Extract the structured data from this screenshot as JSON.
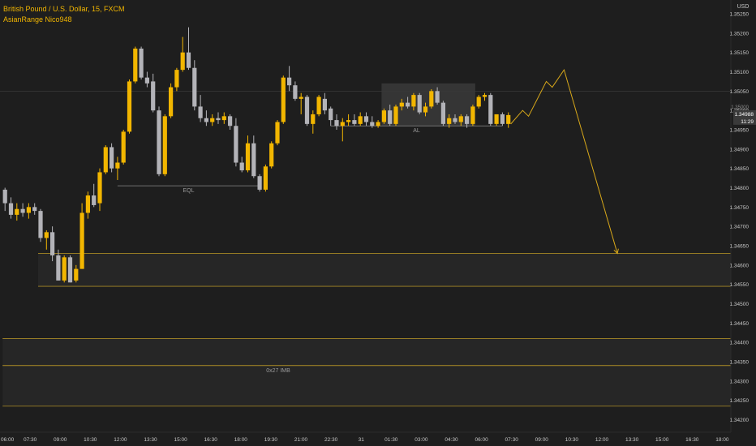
{
  "legend": {
    "symbol_line": "British Pound / U.S. Dollar, 15, FXCM",
    "indicator_line": "AsianRange Nico948"
  },
  "price_axis": {
    "currency": "USD",
    "current_price": "1.34988",
    "countdown": "11:29",
    "partial_label": "1.35000"
  },
  "colors": {
    "background": "#1e1e1e",
    "bull": "#f2b600",
    "bear": "#b3b3b8",
    "level_line": "#c9a227",
    "axis_text": "#c8c8c8",
    "projection": "#d8a81a"
  },
  "chart_data": {
    "type": "candlestick",
    "title": "British Pound / U.S. Dollar, 15, FXCM",
    "ylim": [
      1.34215,
      1.35275
    ],
    "y_ticks": [
      "1.35250",
      "1.35200",
      "1.35150",
      "1.35100",
      "1.35050",
      "1.35000",
      "1.34950",
      "1.34900",
      "1.34850",
      "1.34800",
      "1.34750",
      "1.34700",
      "1.34650",
      "1.34600",
      "1.34550",
      "1.34500",
      "1.34450",
      "1.34400",
      "1.34350",
      "1.34300",
      "1.34250",
      "1.34200"
    ],
    "x_tick_labels": [
      "06:00",
      "07:30",
      "09:00",
      "10:30",
      "12:00",
      "13:30",
      "15:00",
      "16:30",
      "18:00",
      "19:30",
      "21:00",
      "22:30",
      "31",
      "01:30",
      "03:00",
      "04:30",
      "06:00",
      "07:30",
      "09:00",
      "10:30",
      "12:00",
      "13:30",
      "15:00",
      "16:30",
      "18:00"
    ],
    "bar_interval_minutes": 15,
    "candles": [
      {
        "o": 1.34795,
        "h": 1.348,
        "l": 1.3474,
        "c": 1.3476
      },
      {
        "o": 1.3476,
        "h": 1.34775,
        "l": 1.3472,
        "c": 1.3473
      },
      {
        "o": 1.3473,
        "h": 1.3476,
        "l": 1.34715,
        "c": 1.34745
      },
      {
        "o": 1.34745,
        "h": 1.3476,
        "l": 1.34725,
        "c": 1.34735
      },
      {
        "o": 1.34735,
        "h": 1.3476,
        "l": 1.3472,
        "c": 1.3475
      },
      {
        "o": 1.3475,
        "h": 1.3476,
        "l": 1.3473,
        "c": 1.3474
      },
      {
        "o": 1.3474,
        "h": 1.34745,
        "l": 1.3466,
        "c": 1.3467
      },
      {
        "o": 1.3467,
        "h": 1.3469,
        "l": 1.3464,
        "c": 1.34685
      },
      {
        "o": 1.34685,
        "h": 1.347,
        "l": 1.3461,
        "c": 1.34625
      },
      {
        "o": 1.34625,
        "h": 1.3464,
        "l": 1.3456,
        "c": 1.3456
      },
      {
        "o": 1.3456,
        "h": 1.34625,
        "l": 1.34555,
        "c": 1.3462
      },
      {
        "o": 1.3462,
        "h": 1.34625,
        "l": 1.34555,
        "c": 1.34555
      },
      {
        "o": 1.3456,
        "h": 1.346,
        "l": 1.34555,
        "c": 1.3459
      },
      {
        "o": 1.3459,
        "h": 1.3476,
        "l": 1.3459,
        "c": 1.34735
      },
      {
        "o": 1.34735,
        "h": 1.3479,
        "l": 1.3472,
        "c": 1.3478
      },
      {
        "o": 1.3478,
        "h": 1.3481,
        "l": 1.3475,
        "c": 1.34755
      },
      {
        "o": 1.3476,
        "h": 1.3485,
        "l": 1.3474,
        "c": 1.3484
      },
      {
        "o": 1.3484,
        "h": 1.3491,
        "l": 1.34835,
        "c": 1.34905
      },
      {
        "o": 1.34905,
        "h": 1.34915,
        "l": 1.3484,
        "c": 1.3485
      },
      {
        "o": 1.3485,
        "h": 1.3488,
        "l": 1.3482,
        "c": 1.34865
      },
      {
        "o": 1.34865,
        "h": 1.3495,
        "l": 1.3486,
        "c": 1.34945
      },
      {
        "o": 1.34945,
        "h": 1.3508,
        "l": 1.3494,
        "c": 1.35075
      },
      {
        "o": 1.35075,
        "h": 1.35165,
        "l": 1.3507,
        "c": 1.3516
      },
      {
        "o": 1.3516,
        "h": 1.35165,
        "l": 1.3508,
        "c": 1.35085
      },
      {
        "o": 1.35085,
        "h": 1.351,
        "l": 1.3506,
        "c": 1.3507
      },
      {
        "o": 1.35075,
        "h": 1.35095,
        "l": 1.34995,
        "c": 1.35
      },
      {
        "o": 1.35,
        "h": 1.3501,
        "l": 1.3483,
        "c": 1.34835
      },
      {
        "o": 1.34835,
        "h": 1.3499,
        "l": 1.3483,
        "c": 1.34985
      },
      {
        "o": 1.34985,
        "h": 1.3507,
        "l": 1.3498,
        "c": 1.3506
      },
      {
        "o": 1.3506,
        "h": 1.3511,
        "l": 1.3505,
        "c": 1.35105
      },
      {
        "o": 1.35105,
        "h": 1.3519,
        "l": 1.351,
        "c": 1.3515
      },
      {
        "o": 1.3515,
        "h": 1.35215,
        "l": 1.35105,
        "c": 1.3511
      },
      {
        "o": 1.3511,
        "h": 1.3513,
        "l": 1.35,
        "c": 1.3501
      },
      {
        "o": 1.3501,
        "h": 1.3504,
        "l": 1.3497,
        "c": 1.3498
      },
      {
        "o": 1.3498,
        "h": 1.35,
        "l": 1.3496,
        "c": 1.3497
      },
      {
        "o": 1.3497,
        "h": 1.3499,
        "l": 1.3496,
        "c": 1.3498
      },
      {
        "o": 1.3498,
        "h": 1.34995,
        "l": 1.34965,
        "c": 1.34975
      },
      {
        "o": 1.34975,
        "h": 1.34995,
        "l": 1.34965,
        "c": 1.34985
      },
      {
        "o": 1.34985,
        "h": 1.3499,
        "l": 1.3495,
        "c": 1.3496
      },
      {
        "o": 1.3496,
        "h": 1.3498,
        "l": 1.34855,
        "c": 1.34865
      },
      {
        "o": 1.34865,
        "h": 1.3488,
        "l": 1.3484,
        "c": 1.34845
      },
      {
        "o": 1.34845,
        "h": 1.34935,
        "l": 1.3484,
        "c": 1.34915
      },
      {
        "o": 1.34915,
        "h": 1.34935,
        "l": 1.34825,
        "c": 1.3483
      },
      {
        "o": 1.3483,
        "h": 1.34835,
        "l": 1.3479,
        "c": 1.34795
      },
      {
        "o": 1.34795,
        "h": 1.3486,
        "l": 1.3479,
        "c": 1.34855
      },
      {
        "o": 1.34855,
        "h": 1.3492,
        "l": 1.3485,
        "c": 1.34915
      },
      {
        "o": 1.34915,
        "h": 1.34975,
        "l": 1.3491,
        "c": 1.3497
      },
      {
        "o": 1.3497,
        "h": 1.3509,
        "l": 1.34965,
        "c": 1.35085
      },
      {
        "o": 1.35085,
        "h": 1.35115,
        "l": 1.3505,
        "c": 1.35065
      },
      {
        "o": 1.35065,
        "h": 1.35075,
        "l": 1.35025,
        "c": 1.3503
      },
      {
        "o": 1.3503,
        "h": 1.35045,
        "l": 1.3499,
        "c": 1.35035
      },
      {
        "o": 1.35035,
        "h": 1.3504,
        "l": 1.3496,
        "c": 1.34965
      },
      {
        "o": 1.34965,
        "h": 1.35,
        "l": 1.3494,
        "c": 1.3499
      },
      {
        "o": 1.3499,
        "h": 1.3504,
        "l": 1.34985,
        "c": 1.35035
      },
      {
        "o": 1.3503,
        "h": 1.35045,
        "l": 1.3499,
        "c": 1.35
      },
      {
        "o": 1.35005,
        "h": 1.3501,
        "l": 1.3496,
        "c": 1.34975
      },
      {
        "o": 1.34975,
        "h": 1.3499,
        "l": 1.3495,
        "c": 1.3496
      },
      {
        "o": 1.3496,
        "h": 1.3498,
        "l": 1.3492,
        "c": 1.3497
      },
      {
        "o": 1.3497,
        "h": 1.3499,
        "l": 1.3496,
        "c": 1.34975
      },
      {
        "o": 1.34975,
        "h": 1.3499,
        "l": 1.3496,
        "c": 1.34965
      },
      {
        "o": 1.34965,
        "h": 1.34995,
        "l": 1.3496,
        "c": 1.34985
      },
      {
        "o": 1.34985,
        "h": 1.34995,
        "l": 1.3496,
        "c": 1.3497
      },
      {
        "o": 1.3497,
        "h": 1.34985,
        "l": 1.34955,
        "c": 1.3496
      },
      {
        "o": 1.3496,
        "h": 1.34975,
        "l": 1.34955,
        "c": 1.3497
      },
      {
        "o": 1.3497,
        "h": 1.35005,
        "l": 1.34965,
        "c": 1.35
      },
      {
        "o": 1.35,
        "h": 1.35015,
        "l": 1.3496,
        "c": 1.34965
      },
      {
        "o": 1.34965,
        "h": 1.35015,
        "l": 1.3496,
        "c": 1.3501
      },
      {
        "o": 1.3501,
        "h": 1.3503,
        "l": 1.35,
        "c": 1.3502
      },
      {
        "o": 1.3502,
        "h": 1.35035,
        "l": 1.35005,
        "c": 1.3501
      },
      {
        "o": 1.3501,
        "h": 1.35045,
        "l": 1.35,
        "c": 1.3504
      },
      {
        "o": 1.3504,
        "h": 1.35045,
        "l": 1.3499,
        "c": 1.34995
      },
      {
        "o": 1.34995,
        "h": 1.3502,
        "l": 1.34985,
        "c": 1.3501
      },
      {
        "o": 1.3501,
        "h": 1.35055,
        "l": 1.35005,
        "c": 1.3505
      },
      {
        "o": 1.3505,
        "h": 1.3506,
        "l": 1.35015,
        "c": 1.3502
      },
      {
        "o": 1.3502,
        "h": 1.35025,
        "l": 1.3496,
        "c": 1.34965
      },
      {
        "o": 1.34965,
        "h": 1.3499,
        "l": 1.34955,
        "c": 1.3498
      },
      {
        "o": 1.3498,
        "h": 1.3499,
        "l": 1.34965,
        "c": 1.3497
      },
      {
        "o": 1.3497,
        "h": 1.3499,
        "l": 1.3496,
        "c": 1.34985
      },
      {
        "o": 1.34985,
        "h": 1.3499,
        "l": 1.34955,
        "c": 1.34965
      },
      {
        "o": 1.34965,
        "h": 1.35015,
        "l": 1.3496,
        "c": 1.3501
      },
      {
        "o": 1.3501,
        "h": 1.3504,
        "l": 1.35005,
        "c": 1.35035
      },
      {
        "o": 1.35035,
        "h": 1.35045,
        "l": 1.35025,
        "c": 1.3504
      },
      {
        "o": 1.3504,
        "h": 1.35045,
        "l": 1.3496,
        "c": 1.34965
      },
      {
        "o": 1.34965,
        "h": 1.3499,
        "l": 1.3496,
        "c": 1.3499
      },
      {
        "o": 1.3499,
        "h": 1.34995,
        "l": 1.3496,
        "c": 1.34965
      },
      {
        "o": 1.34965,
        "h": 1.34995,
        "l": 1.34955,
        "c": 1.34988
      }
    ],
    "zones": [
      {
        "from_index": 6,
        "to_end": true,
        "top": 1.3463,
        "bottom": 1.34545,
        "label": ""
      },
      {
        "from_index": 0,
        "to_end": true,
        "top": 1.3441,
        "bottom": 1.3434,
        "label": ""
      },
      {
        "from_index": 0,
        "to_end": true,
        "top": 1.3434,
        "bottom": 1.34235,
        "label": "0x27 IMB"
      },
      {
        "from_index": 64,
        "to_index": 79,
        "top": 1.3507,
        "bottom": 1.3496,
        "label": ""
      }
    ],
    "levels": [
      {
        "label": "EQL",
        "price": 1.34805,
        "from_index": 19,
        "to_index": 43
      },
      {
        "label": "AL",
        "price": 1.3496,
        "from_index": 55,
        "to_index": 84
      }
    ],
    "projection": [
      {
        "bars_after_last": 0,
        "price": 1.34965
      },
      {
        "bars_after_last": 2,
        "price": 1.35
      },
      {
        "bars_after_last": 3,
        "price": 1.34985
      },
      {
        "bars_after_last": 6,
        "price": 1.35075
      },
      {
        "bars_after_last": 7,
        "price": 1.3506
      },
      {
        "bars_after_last": 9,
        "price": 1.35105
      },
      {
        "bars_after_last": 18,
        "price": 1.3463
      }
    ]
  }
}
